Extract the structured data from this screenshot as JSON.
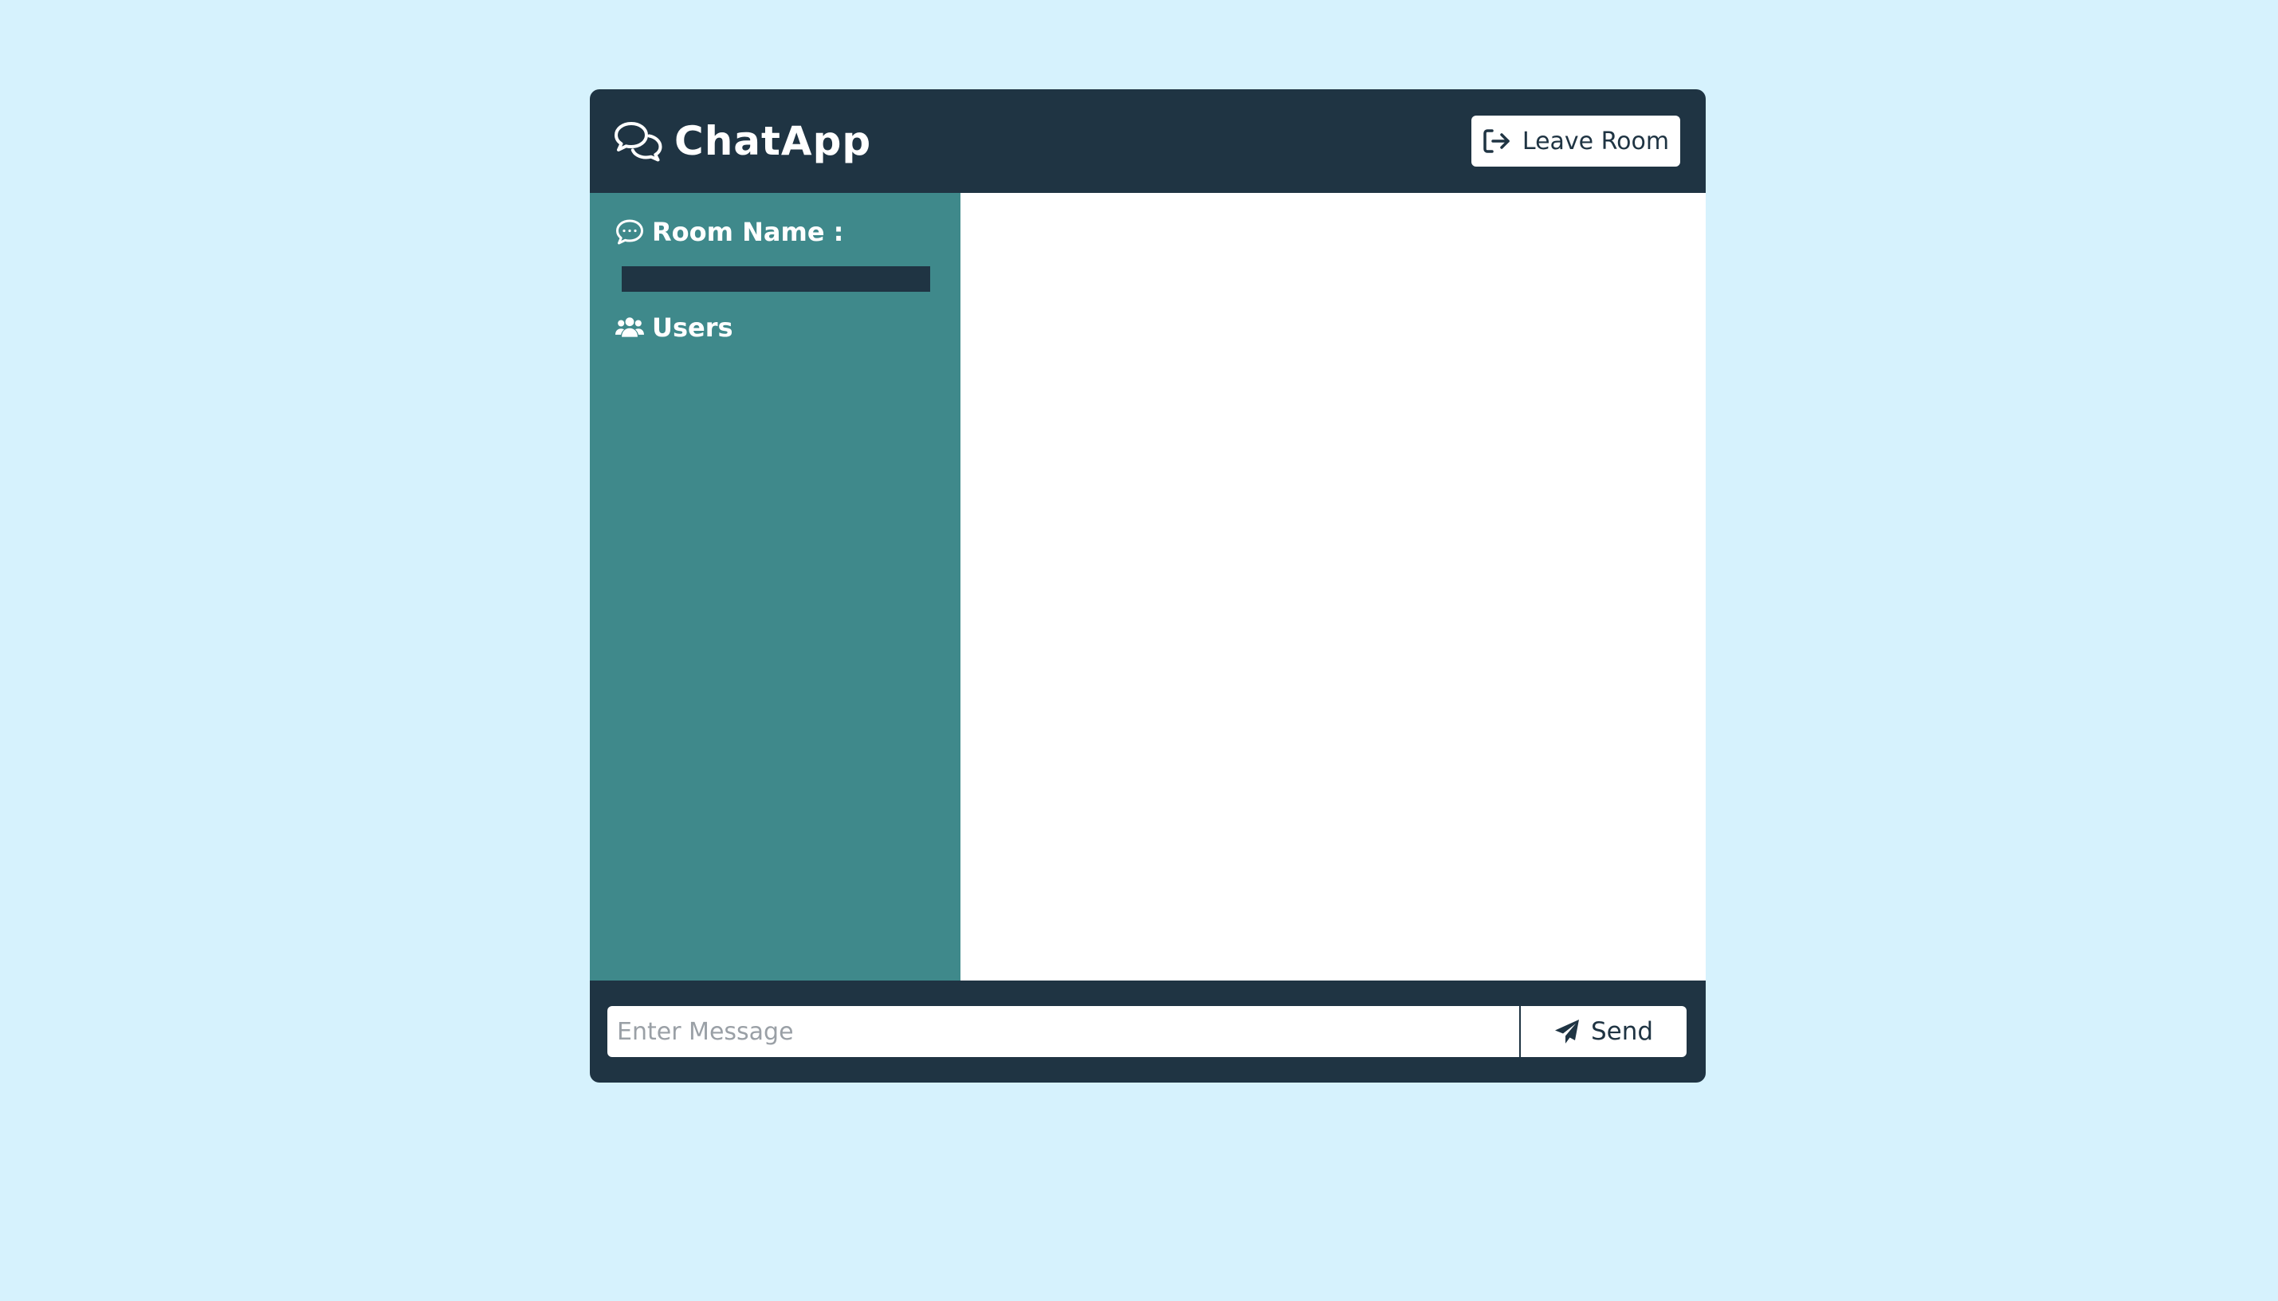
{
  "header": {
    "title": "ChatApp",
    "brand_icon": "comments-icon",
    "leave_button_label": "Leave Room",
    "leave_icon": "sign-out-icon"
  },
  "sidebar": {
    "room_heading": "Room Name :",
    "room_icon": "comment-dots-icon",
    "room_name_value": "",
    "users_heading": "Users",
    "users_icon": "users-icon",
    "users": []
  },
  "messages": [],
  "composer": {
    "placeholder": "Enter Message",
    "value": "",
    "send_label": "Send",
    "send_icon": "paper-plane-icon"
  },
  "colors": {
    "page_background": "#d6f2fd",
    "header_background": "#1f3443",
    "sidebar_background": "#3f898b",
    "chat_background": "#ffffff",
    "text_light": "#ffffff",
    "text_dark": "#1f3443"
  }
}
